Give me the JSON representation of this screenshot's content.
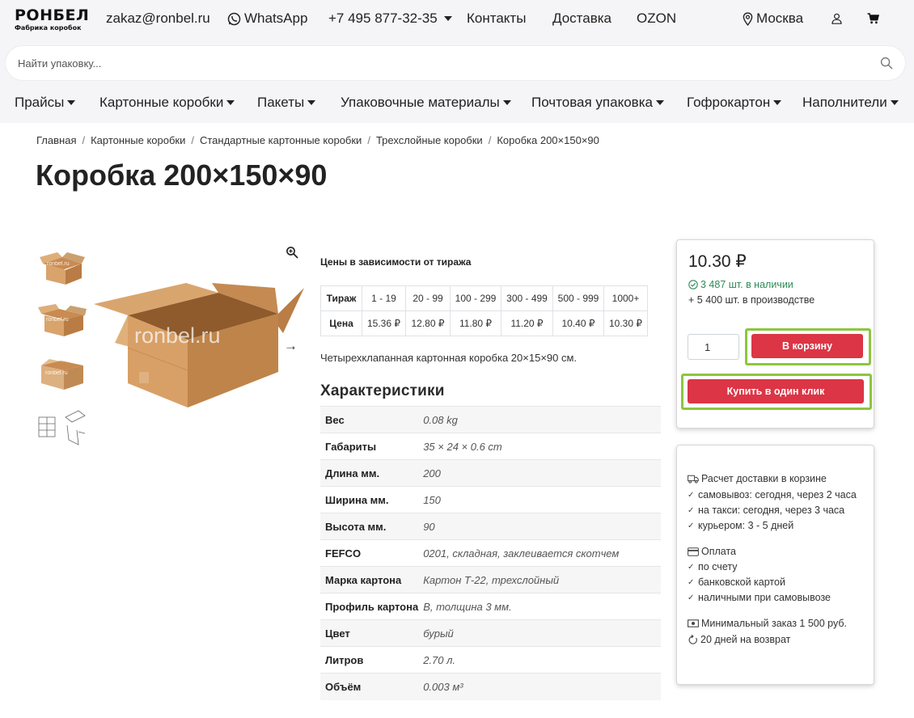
{
  "header": {
    "logo_main": "РОНБЕЛ",
    "logo_sub": "Фабрика коробок",
    "email": "zakaz@ronbel.ru",
    "whatsapp": "WhatsApp",
    "phone": "+7 495 877-32-35",
    "contacts": "Контакты",
    "delivery": "Доставка",
    "ozon": "OZON",
    "city": "Москва",
    "icons": [
      "whatsapp-icon",
      "location-pin-icon",
      "user-icon",
      "cart-icon"
    ]
  },
  "search": {
    "placeholder": "Найти упаковку..."
  },
  "nav": {
    "items": [
      "Прайсы",
      "Картонные коробки",
      "Пакеты",
      "Упаковочные материалы",
      "Почтовая упаковка",
      "Гофрокартон",
      "Наполнители"
    ]
  },
  "breadcrumb": [
    "Главная",
    "Картонные коробки",
    "Стандартные картонные коробки",
    "Трехслойные коробки",
    "Коробка 200×150×90"
  ],
  "product": {
    "title": "Коробка 200×150×90",
    "watermark": "ronbel.ru",
    "tier_heading": "Цены в зависимости от тиража",
    "tier_label_qty": "Тираж",
    "tier_label_price": "Цена",
    "tiers": [
      {
        "qty": "1 - 19",
        "price": "15.36 ₽"
      },
      {
        "qty": "20 - 99",
        "price": "12.80 ₽"
      },
      {
        "qty": "100 - 299",
        "price": "11.80 ₽"
      },
      {
        "qty": "300 - 499",
        "price": "11.20 ₽"
      },
      {
        "qty": "500 - 999",
        "price": "10.40 ₽"
      },
      {
        "qty": "1000+",
        "price": "10.30 ₽"
      }
    ],
    "short_description": "Четырехклапанная картонная коробка 20×15×90 см.",
    "specs_heading": "Характеристики",
    "specs": [
      {
        "key": "Вес",
        "value": "0.08 kg"
      },
      {
        "key": "Габариты",
        "value": "35 × 24 × 0.6 cm"
      },
      {
        "key": "Длина мм.",
        "value": "200"
      },
      {
        "key": "Ширина мм.",
        "value": "150"
      },
      {
        "key": "Высота мм.",
        "value": "90"
      },
      {
        "key": "FEFCO",
        "value": "0201, складная, заклеивается скотчем"
      },
      {
        "key": "Марка картона",
        "value": "Картон Т-22, трехслойный"
      },
      {
        "key": "Профиль картона",
        "value": "В, толщина 3 мм."
      },
      {
        "key": "Цвет",
        "value": "бурый"
      },
      {
        "key": "Литров",
        "value": "2.70 л."
      },
      {
        "key": "Объём",
        "value": "0.003 м³"
      }
    ]
  },
  "buy": {
    "price": "10.30 ₽",
    "in_stock": "3 487 шт. в наличии",
    "in_production": "+ 5 400 шт. в производстве",
    "quantity": "1",
    "add_to_cart": "В корзину",
    "one_click": "Купить в один клик",
    "accent_red": "#dc3545",
    "highlight_green": "#8cc63f"
  },
  "info": {
    "delivery_title": "Расчет доставки в корзине",
    "delivery_items": [
      "самовывоз: сегодня, через 2 часа",
      "на такси: сегодня, через 3 часа",
      "курьером: 3 - 5 дней"
    ],
    "payment_title": "Оплата",
    "payment_items": [
      "по счету",
      "банковской картой",
      "наличными при самовывозе"
    ],
    "min_order": "Минимальный заказ 1 500 руб.",
    "returns": "20 дней на возврат"
  }
}
